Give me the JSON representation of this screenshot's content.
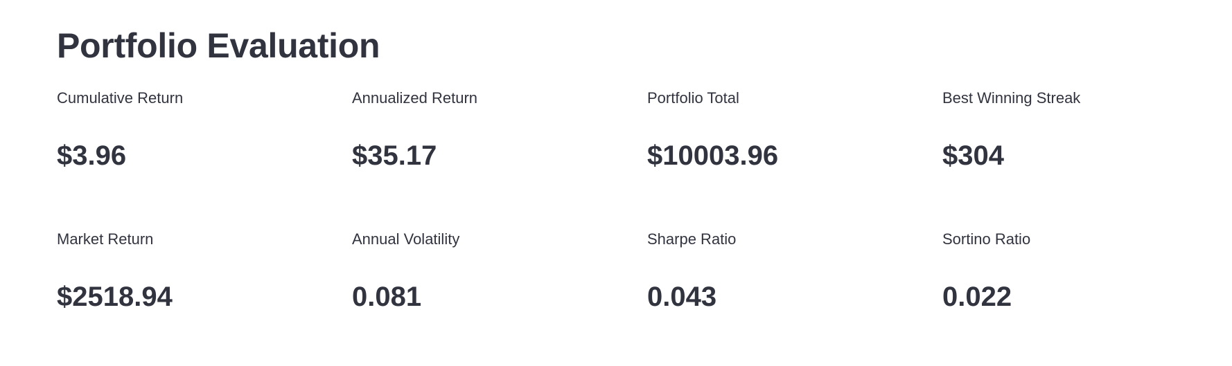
{
  "page": {
    "title": "Portfolio Evaluation"
  },
  "metrics": [
    {
      "label": "Cumulative Return",
      "value": "$3.96"
    },
    {
      "label": "Annualized Return",
      "value": "$35.17"
    },
    {
      "label": "Portfolio Total",
      "value": "$10003.96"
    },
    {
      "label": "Best Winning Streak",
      "value": "$304"
    },
    {
      "label": "Market Return",
      "value": "$2518.94"
    },
    {
      "label": "Annual Volatility",
      "value": "0.081"
    },
    {
      "label": "Sharpe Ratio",
      "value": "0.043"
    },
    {
      "label": "Sortino Ratio",
      "value": "0.022"
    }
  ],
  "colors": {
    "text": "#31333f",
    "background": "#ffffff"
  }
}
